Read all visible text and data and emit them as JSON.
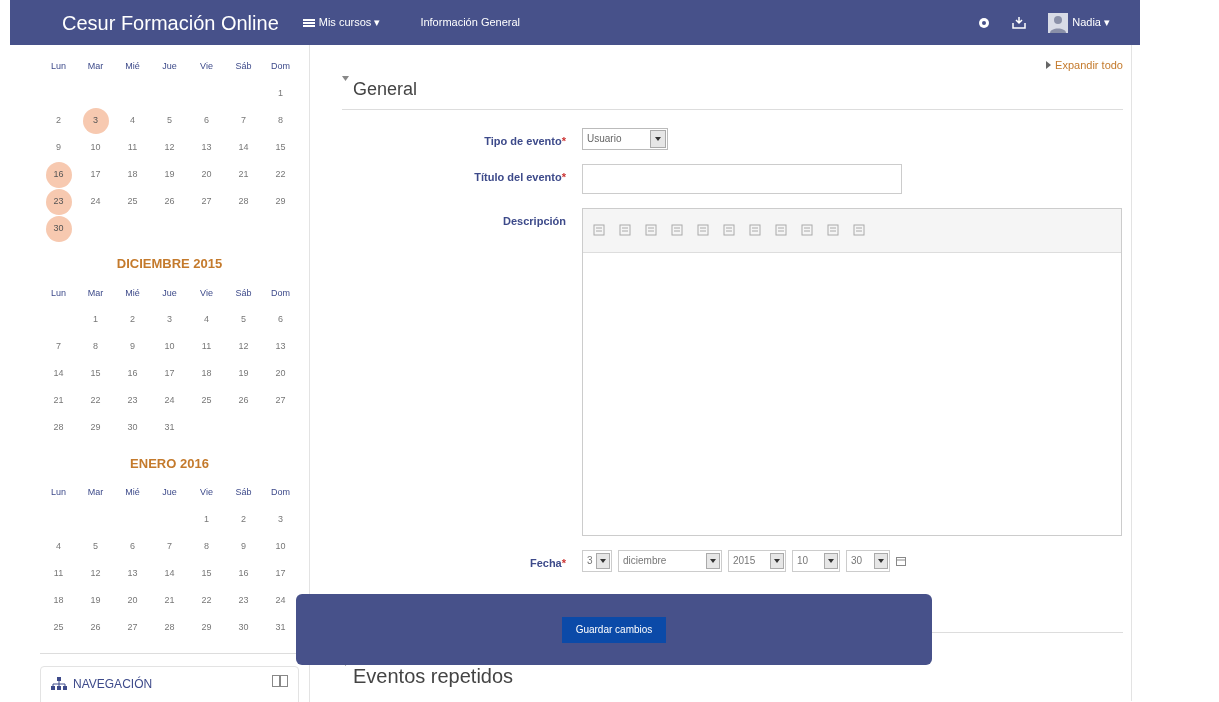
{
  "navbar": {
    "brand": "Cesur Formación Online",
    "menu": [
      {
        "label": "Mis cursos ▾",
        "icon": true
      },
      {
        "label": "Información General",
        "icon": false
      }
    ],
    "user": "Nadia ▾"
  },
  "calendars": [
    {
      "weekdays": [
        "Lun",
        "Mar",
        "Mié",
        "Jue",
        "Vie",
        "Sáb",
        "Dom"
      ],
      "weeks": [
        {
          "days": [
            {
              "day": "1",
              "event": false
            }
          ]
        },
        {
          "days": [
            {
              "day": "2",
              "event": false
            },
            {
              "day": "3",
              "event": true
            },
            {
              "day": "4",
              "event": false
            },
            {
              "day": "5",
              "event": false
            },
            {
              "day": "6",
              "event": false
            },
            {
              "day": "7",
              "event": false
            },
            {
              "day": "8",
              "event": false
            }
          ]
        },
        {
          "days": [
            {
              "day": "9",
              "event": false
            },
            {
              "day": "10",
              "event": false
            },
            {
              "day": "11",
              "event": false
            },
            {
              "day": "12",
              "event": false
            },
            {
              "day": "13",
              "event": false
            },
            {
              "day": "14",
              "event": false
            },
            {
              "day": "15",
              "event": false
            }
          ]
        },
        {
          "days": [
            {
              "day": "16",
              "event": true
            },
            {
              "day": "17",
              "event": false
            },
            {
              "day": "18",
              "event": false
            },
            {
              "day": "19",
              "event": false
            },
            {
              "day": "20",
              "event": false
            },
            {
              "day": "21",
              "event": false
            },
            {
              "day": "22",
              "event": false
            }
          ]
        },
        {
          "days": [
            {
              "day": "23",
              "event": true
            },
            {
              "day": "24",
              "event": false
            },
            {
              "day": "25",
              "event": false
            },
            {
              "day": "26",
              "event": false
            },
            {
              "day": "27",
              "event": false
            },
            {
              "day": "28",
              "event": false
            },
            {
              "day": "29",
              "event": false
            }
          ]
        },
        {
          "days": [
            {
              "day": "30",
              "event": true
            }
          ]
        }
      ]
    },
    {
      "title": "DICIEMBRE 2015",
      "weekdays": [
        "Lun",
        "Mar",
        "Mié",
        "Jue",
        "Vie",
        "Sáb",
        "Dom"
      ],
      "weeks": [
        {
          "days": [
            {
              "day": "1",
              "event": false
            },
            {
              "day": "2",
              "event": false
            },
            {
              "day": "3",
              "event": false
            },
            {
              "day": "4",
              "event": false
            },
            {
              "day": "5",
              "event": false
            },
            {
              "day": "6",
              "event": false
            }
          ]
        },
        {
          "days": [
            {
              "day": "7",
              "event": false
            },
            {
              "day": "8",
              "event": false
            },
            {
              "day": "9",
              "event": false
            },
            {
              "day": "10",
              "event": false
            },
            {
              "day": "11",
              "event": false
            },
            {
              "day": "12",
              "event": false
            },
            {
              "day": "13",
              "event": false
            }
          ]
        },
        {
          "days": [
            {
              "day": "14",
              "event": false
            },
            {
              "day": "15",
              "event": false
            },
            {
              "day": "16",
              "event": false
            },
            {
              "day": "17",
              "event": false
            },
            {
              "day": "18",
              "event": false
            },
            {
              "day": "19",
              "event": false
            },
            {
              "day": "20",
              "event": false
            }
          ]
        },
        {
          "days": [
            {
              "day": "21",
              "event": false
            },
            {
              "day": "22",
              "event": false
            },
            {
              "day": "23",
              "event": false
            },
            {
              "day": "24",
              "event": false
            },
            {
              "day": "25",
              "event": false
            },
            {
              "day": "26",
              "event": false
            },
            {
              "day": "27",
              "event": false
            }
          ]
        },
        {
          "days": [
            {
              "day": "28",
              "event": false
            },
            {
              "day": "29",
              "event": false
            },
            {
              "day": "30",
              "event": false
            },
            {
              "day": "31",
              "event": false
            }
          ]
        }
      ]
    },
    {
      "title": "ENERO 2016",
      "weekdays": [
        "Lun",
        "Mar",
        "Mié",
        "Jue",
        "Vie",
        "Sáb",
        "Dom"
      ],
      "weeks": [
        {
          "days": [
            {
              "day": "1",
              "event": false
            },
            {
              "day": "2",
              "event": false
            },
            {
              "day": "3",
              "event": false
            }
          ]
        },
        {
          "days": [
            {
              "day": "4",
              "event": false
            },
            {
              "day": "5",
              "event": false
            },
            {
              "day": "6",
              "event": false
            },
            {
              "day": "7",
              "event": false
            },
            {
              "day": "8",
              "event": false
            },
            {
              "day": "9",
              "event": false
            },
            {
              "day": "10",
              "event": false
            }
          ]
        },
        {
          "days": [
            {
              "day": "11",
              "event": false
            },
            {
              "day": "12",
              "event": false
            },
            {
              "day": "13",
              "event": false
            },
            {
              "day": "14",
              "event": false
            },
            {
              "day": "15",
              "event": false
            },
            {
              "day": "16",
              "event": false
            },
            {
              "day": "17",
              "event": false
            }
          ]
        },
        {
          "days": [
            {
              "day": "18",
              "event": false
            },
            {
              "day": "19",
              "event": false
            },
            {
              "day": "20",
              "event": false
            },
            {
              "day": "21",
              "event": false
            },
            {
              "day": "22",
              "event": false
            },
            {
              "day": "23",
              "event": false
            },
            {
              "day": "24",
              "event": false
            }
          ]
        },
        {
          "days": [
            {
              "day": "25",
              "event": false
            },
            {
              "day": "26",
              "event": false
            },
            {
              "day": "27",
              "event": false
            },
            {
              "day": "28",
              "event": false
            },
            {
              "day": "29",
              "event": false
            },
            {
              "day": "30",
              "event": false
            },
            {
              "day": "31",
              "event": false
            }
          ]
        }
      ]
    }
  ],
  "navigation_block": {
    "title": "NAVEGACIÓN"
  },
  "main": {
    "expand_all": "Expandir todo",
    "section": "General",
    "fields": [
      {
        "kind": "select",
        "label": "Tipo de evento",
        "required": true,
        "value": "Usuario"
      },
      {
        "kind": "text",
        "label": "Título del evento",
        "required": true
      },
      {
        "kind": "editor",
        "label": "Descripción",
        "required": false
      },
      {
        "kind": "date",
        "label": "Fecha",
        "required": true,
        "parts": [
          "3",
          "diciembre",
          "2015",
          "10",
          "30"
        ]
      }
    ],
    "required_mark": "*",
    "save_button": "Guardar cambios",
    "next_section": "Eventos repetidos"
  }
}
